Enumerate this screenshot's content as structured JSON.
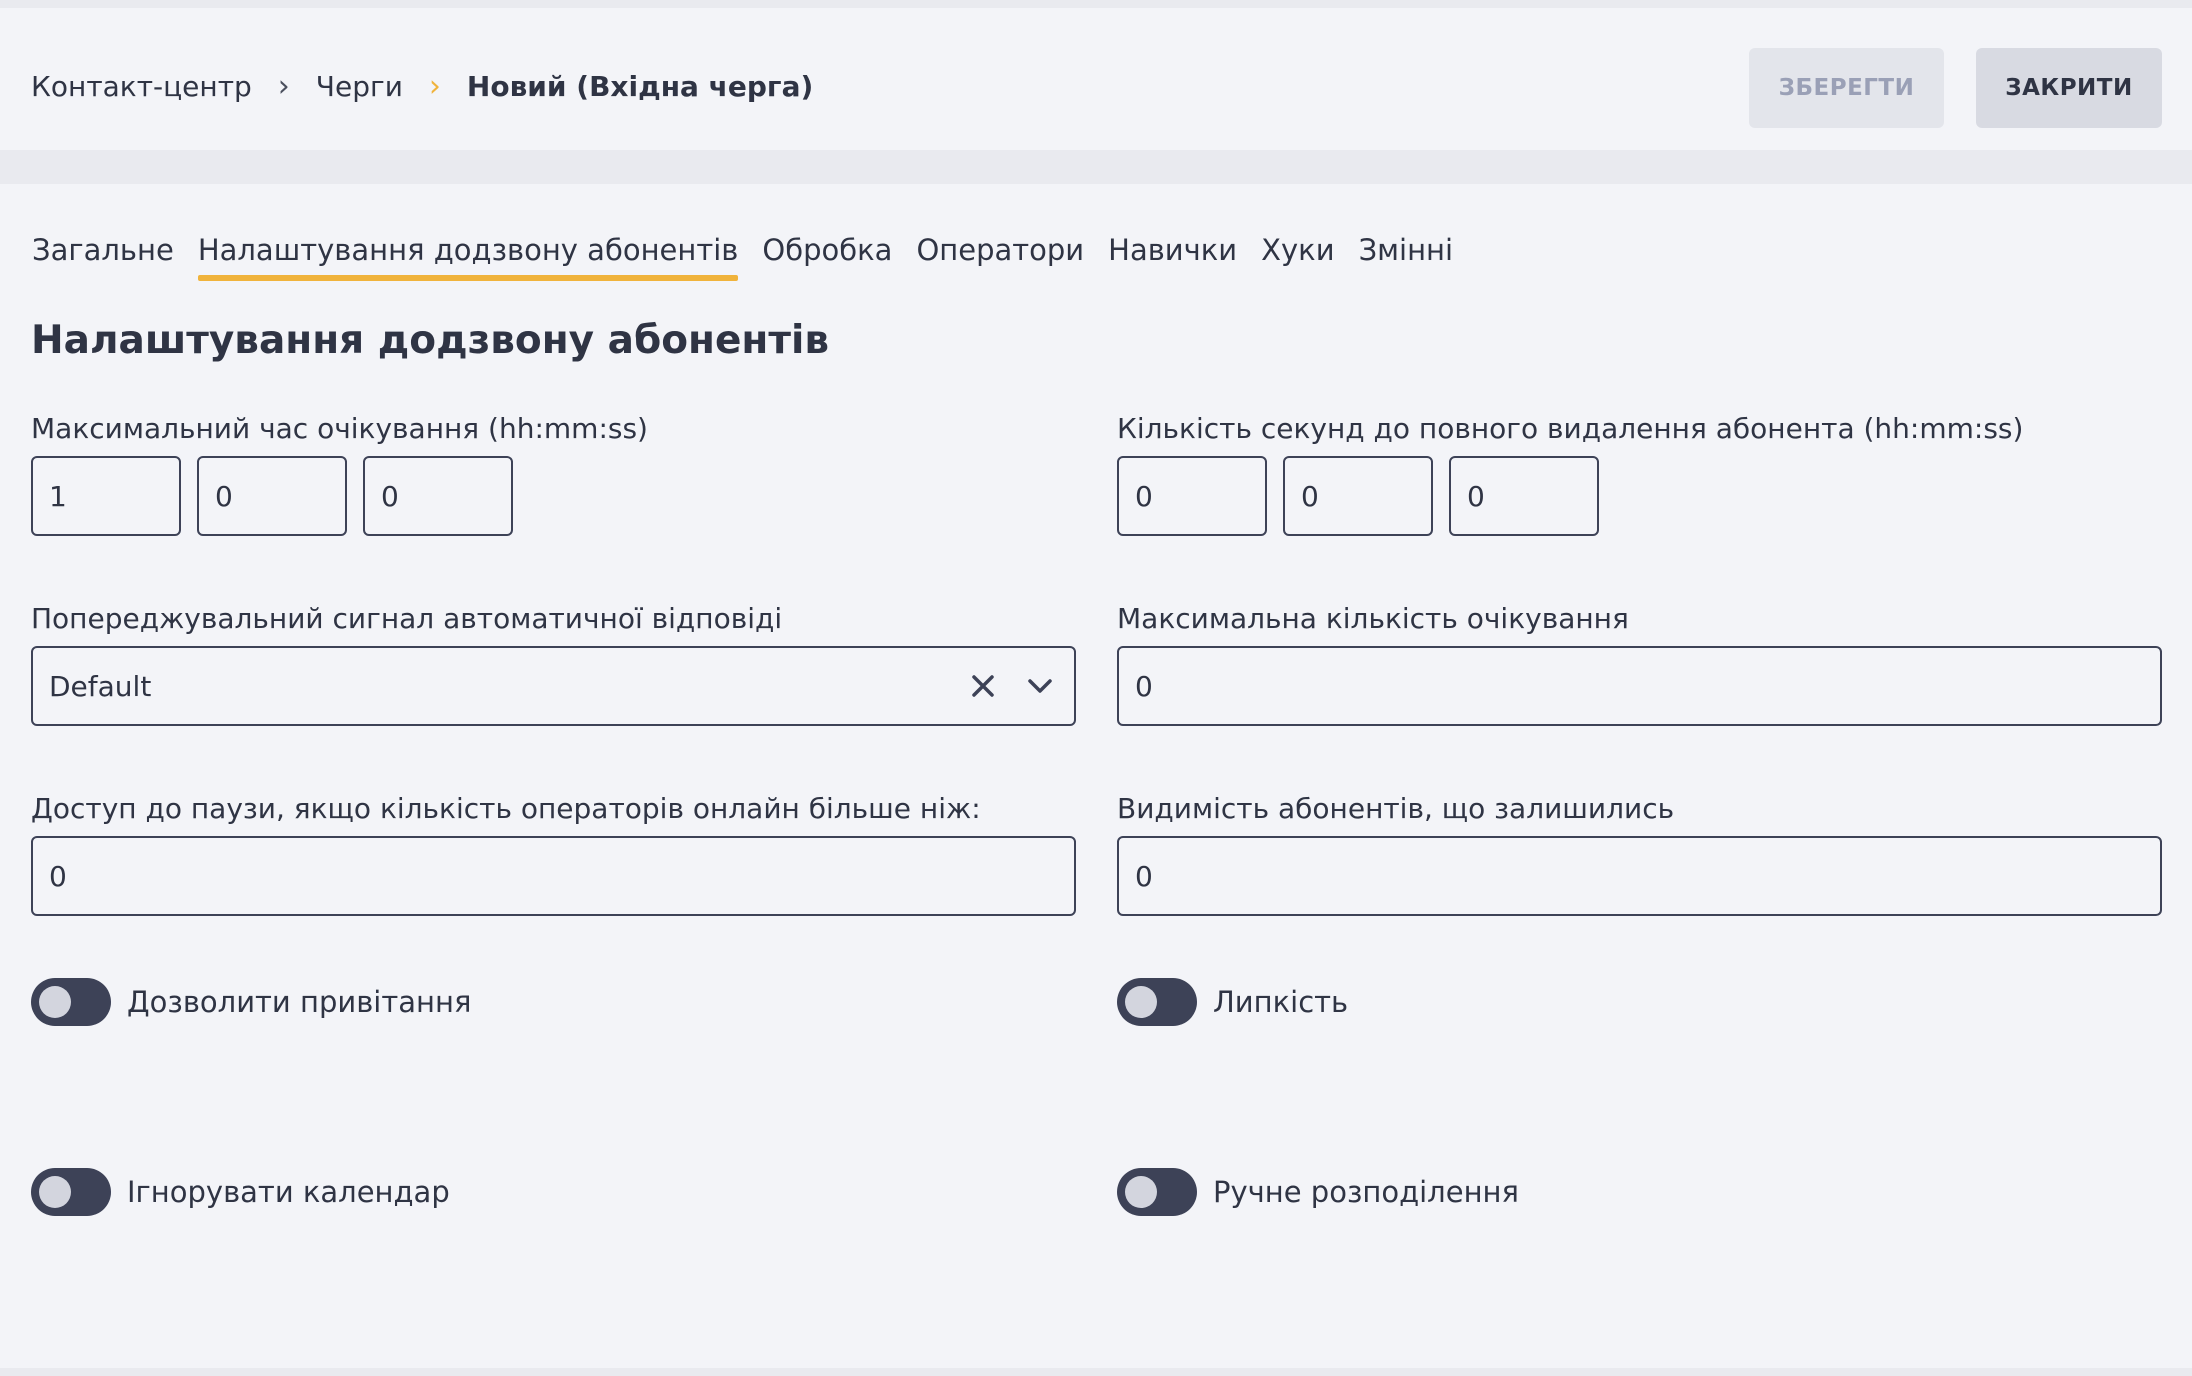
{
  "breadcrumb": {
    "items": [
      "Контакт-центр",
      "Черги"
    ],
    "current": "Новий (Вхідна черга)",
    "separator": "›"
  },
  "actions": {
    "save_label": "ЗБЕРЕГТИ",
    "close_label": "ЗАКРИТИ"
  },
  "tabs": [
    {
      "label": "Загальне",
      "active": false
    },
    {
      "label": "Налаштування додзвону абонентів",
      "active": true
    },
    {
      "label": "Обробка",
      "active": false
    },
    {
      "label": "Оператори",
      "active": false
    },
    {
      "label": "Навички",
      "active": false
    },
    {
      "label": "Хуки",
      "active": false
    },
    {
      "label": "Змінні",
      "active": false
    }
  ],
  "section_title": "Налаштування додзвону абонентів",
  "fields": {
    "max_wait_time": {
      "label": "Максимальний час очікування (hh:mm:ss)",
      "hh": "1",
      "mm": "0",
      "ss": "0"
    },
    "remove_seconds": {
      "label": "Кількість секунд до повного видалення абонента (hh:mm:ss)",
      "hh": "0",
      "mm": "0",
      "ss": "0"
    },
    "auto_answer_signal": {
      "label": "Попереджувальний сигнал автоматичної відповіді",
      "value": "Default"
    },
    "max_waiting_count": {
      "label": "Максимальна кількість очікування",
      "value": "0"
    },
    "pause_access": {
      "label": "Доступ до паузи, якщо кількість операторів онлайн більше ніж:",
      "value": "0"
    },
    "remaining_visibility": {
      "label": "Видимість абонентів, що залишились",
      "value": "0"
    }
  },
  "toggles": {
    "allow_greeting": {
      "label": "Дозволити привітання",
      "on": false
    },
    "stickiness": {
      "label": "Липкість",
      "on": false
    },
    "ignore_calendar": {
      "label": "Ігнорувати календар",
      "on": false
    },
    "manual_distribution": {
      "label": "Ручне розподілення",
      "on": false
    }
  },
  "colors": {
    "accent": "#f0b33c",
    "toggle_track": "#3d4257",
    "text": "#2f3444"
  }
}
